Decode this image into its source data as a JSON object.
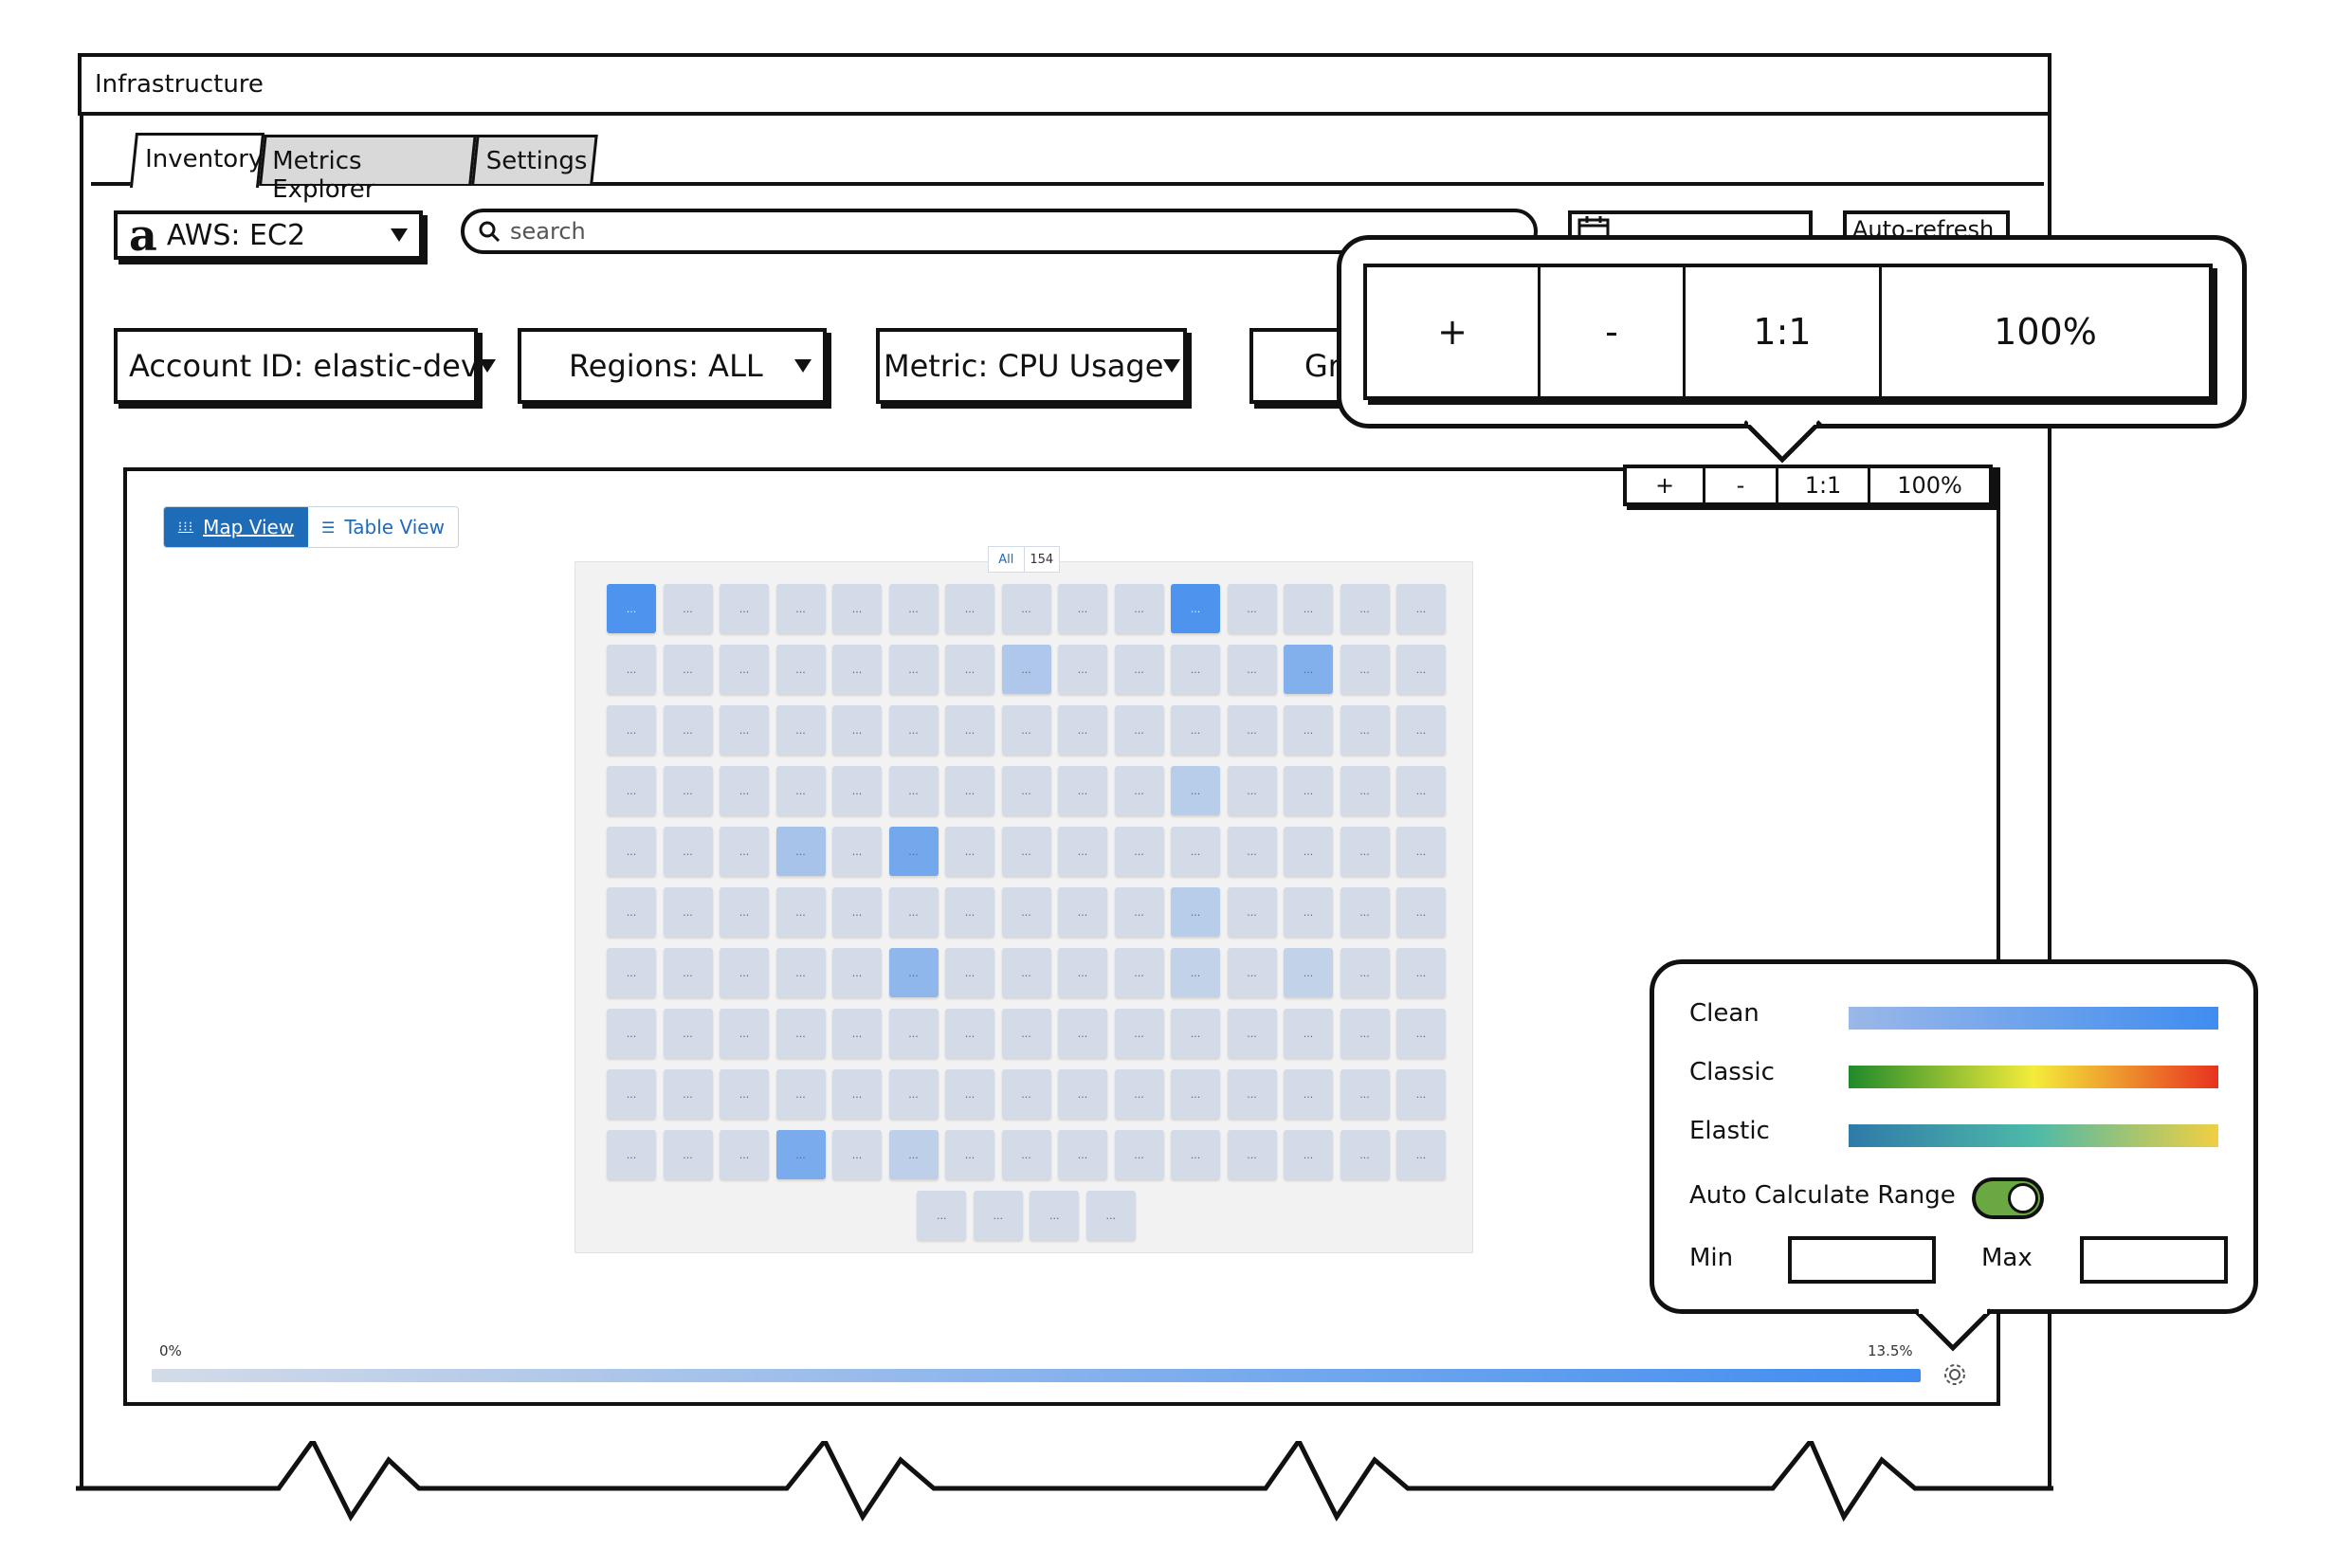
{
  "window": {
    "title": "Infrastructure"
  },
  "tabs": [
    {
      "label": "Inventory",
      "active": true
    },
    {
      "label": "Metrics Explorer",
      "active": false
    },
    {
      "label": "Settings",
      "active": false
    }
  ],
  "toolbar": {
    "source_select": "AWS: EC2",
    "search_placeholder": "search",
    "auto_refresh_label": "Auto-refresh"
  },
  "filters": {
    "account": "Account ID: elastic-dev",
    "regions": "Regions: ALL",
    "metric": "Metric: CPU Usage",
    "group_partial": "Gr"
  },
  "zoom": {
    "in": "+",
    "out": "-",
    "reset": "1:1",
    "level": "100%"
  },
  "view_toggle": {
    "map": "Map View",
    "table": "Table View"
  },
  "group": {
    "name": "All",
    "count": "154"
  },
  "nodes": {
    "placeholder": "...",
    "columns": 15,
    "rows": [
      [
        0.9,
        0,
        0,
        0,
        0,
        0,
        0,
        0,
        0,
        0,
        0.9,
        0,
        0,
        0,
        0
      ],
      [
        0,
        0,
        0,
        0,
        0,
        0,
        0,
        0.25,
        0,
        0,
        0,
        0,
        0.55,
        0,
        0
      ],
      [
        0,
        0,
        0,
        0,
        0,
        0,
        0,
        0,
        0,
        0,
        0,
        0,
        0,
        0,
        0
      ],
      [
        0,
        0,
        0,
        0,
        0,
        0,
        0,
        0,
        0,
        0,
        0.18,
        0,
        0,
        0,
        0
      ],
      [
        0,
        0,
        0,
        0.3,
        0,
        0.65,
        0,
        0,
        0,
        0,
        0,
        0,
        0,
        0,
        0
      ],
      [
        0,
        0,
        0,
        0,
        0,
        0,
        0,
        0,
        0,
        0,
        0.18,
        0,
        0,
        0,
        0
      ],
      [
        0,
        0,
        0,
        0,
        0,
        0.45,
        0,
        0,
        0,
        0,
        0.12,
        0,
        0.12,
        0,
        0
      ],
      [
        0,
        0,
        0,
        0,
        0,
        0,
        0,
        0,
        0,
        0,
        0,
        0,
        0,
        0,
        0
      ],
      [
        0,
        0,
        0,
        0,
        0,
        0,
        0,
        0,
        0,
        0,
        0,
        0,
        0,
        0,
        0
      ],
      [
        0,
        0,
        0,
        0.6,
        0,
        0.15,
        0,
        0,
        0,
        0,
        0,
        0,
        0,
        0,
        0
      ],
      [
        0,
        0,
        0,
        0
      ]
    ]
  },
  "legend": {
    "min_label": "0%",
    "max_label": "13.5%"
  },
  "settings": {
    "palettes": [
      {
        "name": "Clean",
        "gradient": [
          "#9ab8e8",
          "#3f8cf0"
        ]
      },
      {
        "name": "Classic",
        "gradient": [
          "#1f8a2a",
          "#f4ec3a",
          "#e8321f"
        ]
      },
      {
        "name": "Elastic",
        "gradient": [
          "#2f7aa8",
          "#4db9a8",
          "#f0cf42"
        ]
      }
    ],
    "auto_range_label": "Auto Calculate Range",
    "auto_range_on": true,
    "min_label": "Min",
    "max_label": "Max"
  },
  "colors": {
    "node_base": "#d3dbe8",
    "node_high": "#3f8cf0",
    "toggle_on": "#6aa842",
    "accent": "#1e6bb8"
  }
}
